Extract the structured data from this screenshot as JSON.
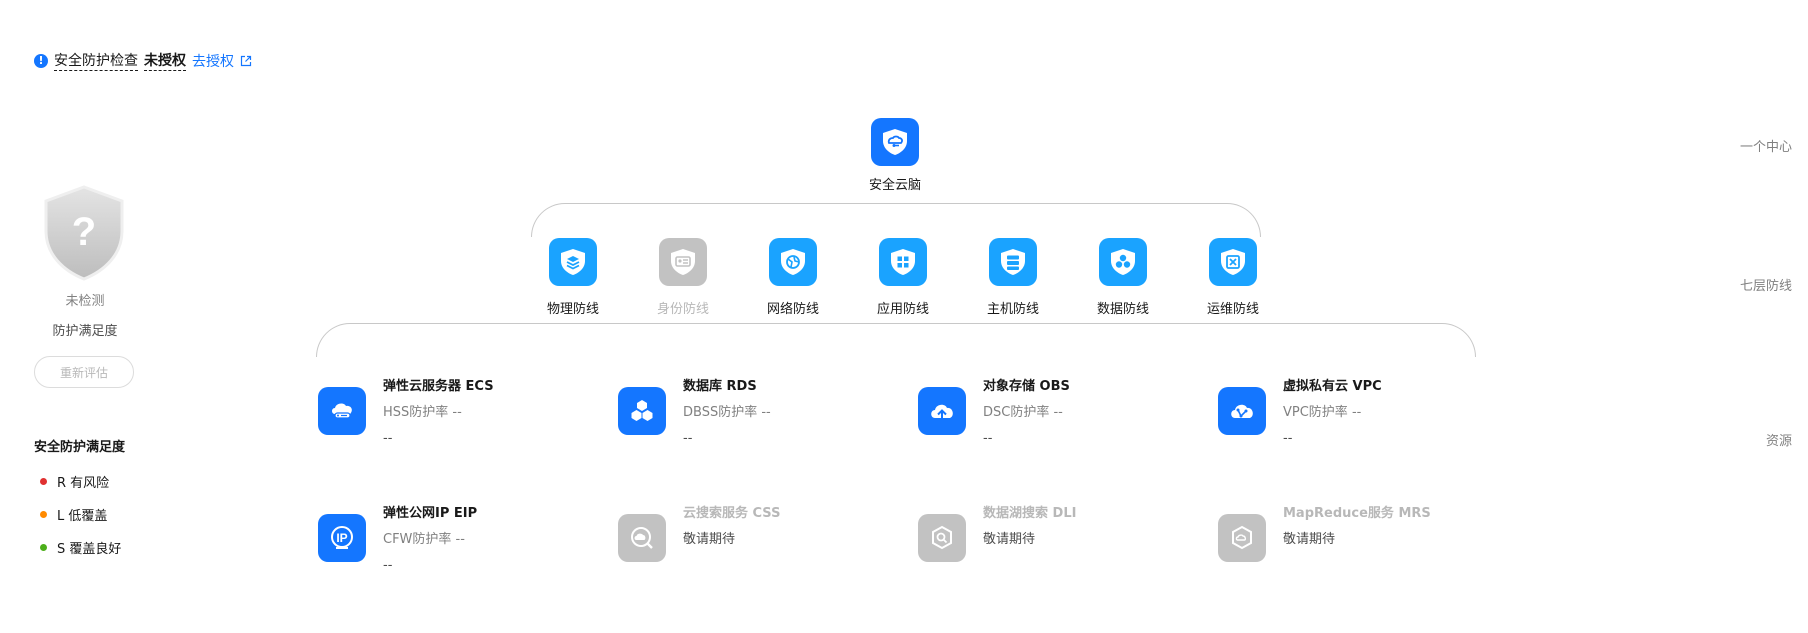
{
  "notice": {
    "icon": "info-icon",
    "check_label": "安全防护检查",
    "status": "未授权",
    "link": "去授权",
    "link_icon": "external-link-icon"
  },
  "left": {
    "status": "未检测",
    "subtitle": "防护满足度",
    "reevaluate": "重新评估",
    "legend_title": "安全防护满足度",
    "legend": [
      {
        "label": "R 有风险",
        "color": "#e03131"
      },
      {
        "label": "L 低覆盖",
        "color": "#ff8a00"
      },
      {
        "label": "S 覆盖良好",
        "color": "#4caf1a"
      }
    ]
  },
  "right_labels": [
    "一个中心",
    "七层防线",
    "资源"
  ],
  "center": {
    "label": "安全云脑",
    "icon": "cloud-brain-icon"
  },
  "layers": [
    {
      "label": "物理防线",
      "icon": "layers-icon",
      "enabled": true
    },
    {
      "label": "身份防线",
      "icon": "id-card-icon",
      "enabled": false
    },
    {
      "label": "网络防线",
      "icon": "network-icon",
      "enabled": true
    },
    {
      "label": "应用防线",
      "icon": "app-grid-icon",
      "enabled": true
    },
    {
      "label": "主机防线",
      "icon": "server-icon",
      "enabled": true
    },
    {
      "label": "数据防线",
      "icon": "data-icon",
      "enabled": true
    },
    {
      "label": "运维防线",
      "icon": "ops-icon",
      "enabled": true
    }
  ],
  "resources": [
    {
      "name": "弹性云服务器 ECS",
      "rate": "HSS防护率 --",
      "value": "--",
      "icon": "ecs-icon",
      "enabled": true
    },
    {
      "name": "数据库 RDS",
      "rate": "DBSS防护率 --",
      "value": "--",
      "icon": "rds-icon",
      "enabled": true
    },
    {
      "name": "对象存储 OBS",
      "rate": "DSC防护率 --",
      "value": "--",
      "icon": "obs-icon",
      "enabled": true
    },
    {
      "name": "虚拟私有云 VPC",
      "rate": "VPC防护率 --",
      "value": "--",
      "icon": "vpc-icon",
      "enabled": true
    },
    {
      "name": "弹性公网IP EIP",
      "rate": "CFW防护率 --",
      "value": "--",
      "icon": "eip-icon",
      "enabled": true
    },
    {
      "name": "云搜索服务 CSS",
      "rate": "敬请期待",
      "value": "",
      "icon": "css-icon",
      "enabled": false
    },
    {
      "name": "数据湖搜索 DLI",
      "rate": "敬请期待",
      "value": "",
      "icon": "dli-icon",
      "enabled": false
    },
    {
      "name": "MapReduce服务 MRS",
      "rate": "敬请期待",
      "value": "",
      "icon": "mrs-icon",
      "enabled": false
    }
  ],
  "colors": {
    "primary": "#1476ff",
    "layer_blue": "#1aa3ff",
    "disabled": "#c2c2c2"
  }
}
